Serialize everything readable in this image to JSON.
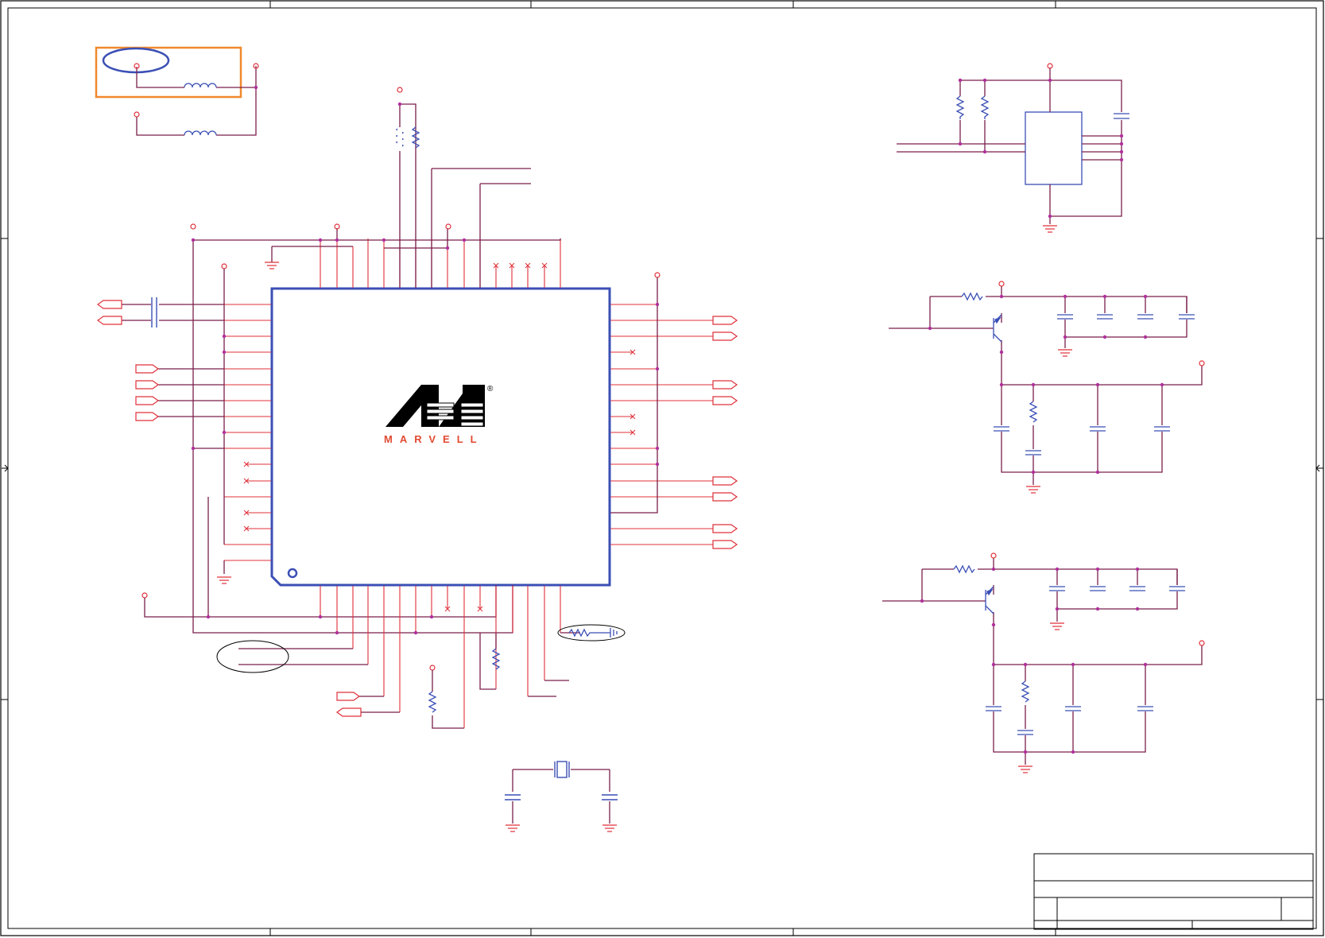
{
  "logo": {
    "wordmark": "MARVELL",
    "registered_mark": "®"
  },
  "colors": {
    "background": "#ffffff",
    "frame": "#000000",
    "wire": "#7a1f4a",
    "pin": "#e0303a",
    "component": "#3b4fb5",
    "junction": "#b0309c",
    "highlight_box": "#f0892d",
    "highlight_ellipse": "#3b4fb5",
    "logo_red": "#e24a33"
  }
}
